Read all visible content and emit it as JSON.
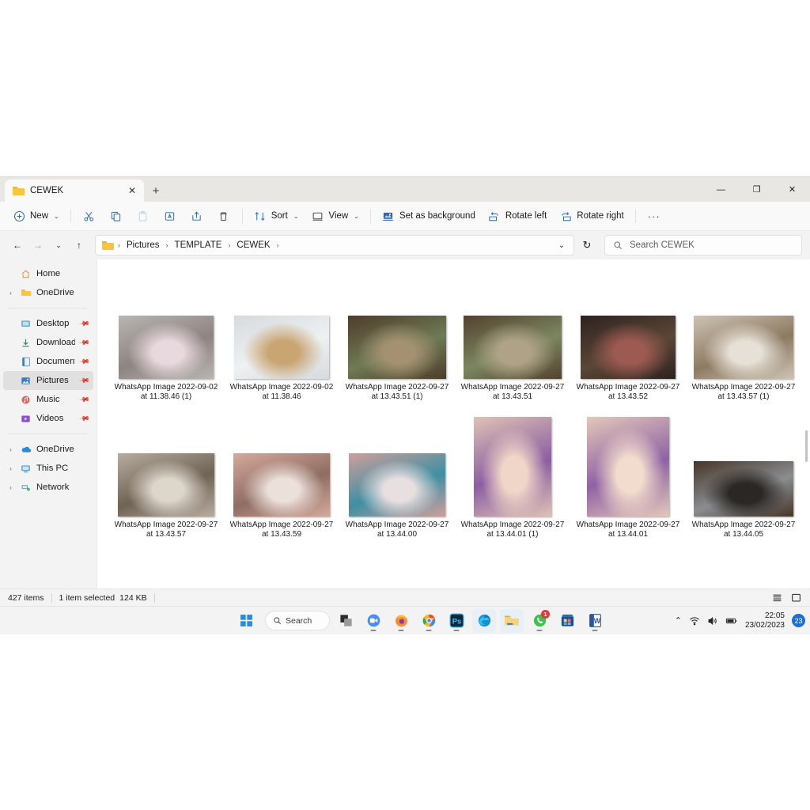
{
  "window": {
    "tab_title": "CEWEK",
    "tab_close": "✕",
    "new_tab": "+",
    "minimize": "—",
    "maximize": "❐",
    "close": "✕"
  },
  "toolbar": {
    "new_label": "New",
    "cut_label": "Cut",
    "copy_label": "Copy",
    "paste_label": "Paste",
    "rename_label": "Rename",
    "share_label": "Share",
    "delete_label": "Delete",
    "sort_label": "Sort",
    "view_label": "View",
    "set_as_background_label": "Set as background",
    "rotate_left_label": "Rotate left",
    "rotate_right_label": "Rotate right",
    "more_label": "···",
    "chevron": "⌄"
  },
  "address": {
    "back": "←",
    "forward": "→",
    "recent": "⌄",
    "up": "↑",
    "crumbs": [
      "Pictures",
      "TEMPLATE",
      "CEWEK"
    ],
    "separator": "›",
    "dropdown": "⌄",
    "refresh": "↻"
  },
  "search": {
    "placeholder": "Search CEWEK"
  },
  "sidebar": {
    "groups": [
      {
        "items": [
          {
            "label": "Home",
            "icon": "home-icon",
            "expand": "",
            "pin": false,
            "selected": false
          },
          {
            "label": "OneDrive",
            "icon": "onedrive-folder-icon",
            "expand": "›",
            "pin": false,
            "selected": false
          }
        ]
      },
      {
        "items": [
          {
            "label": "Desktop",
            "icon": "desktop-icon",
            "expand": "",
            "pin": true,
            "selected": false
          },
          {
            "label": "Downloads",
            "icon": "downloads-icon",
            "expand": "",
            "pin": true,
            "selected": false
          },
          {
            "label": "Documents",
            "icon": "documents-icon",
            "expand": "",
            "pin": true,
            "selected": false
          },
          {
            "label": "Pictures",
            "icon": "pictures-icon",
            "expand": "",
            "pin": true,
            "selected": true
          },
          {
            "label": "Music",
            "icon": "music-icon",
            "expand": "",
            "pin": true,
            "selected": false
          },
          {
            "label": "Videos",
            "icon": "videos-icon",
            "expand": "",
            "pin": true,
            "selected": false
          }
        ]
      },
      {
        "items": [
          {
            "label": "OneDrive",
            "icon": "onedrive-cloud-icon",
            "expand": "›",
            "pin": false,
            "selected": false
          },
          {
            "label": "This PC",
            "icon": "this-pc-icon",
            "expand": "›",
            "pin": false,
            "selected": false
          },
          {
            "label": "Network",
            "icon": "network-icon",
            "expand": "›",
            "pin": false,
            "selected": false
          }
        ]
      }
    ]
  },
  "files": [
    {
      "name": "WhatsApp Image 2022-09-02 at 11.38.46 (1)",
      "w": 120,
      "h": 80,
      "c1": "#b9b5b2",
      "c2": "#e8d9de",
      "c3": "#8d8480",
      "selected": false
    },
    {
      "name": "WhatsApp Image 2022-09-02 at 11.38.46",
      "w": 120,
      "h": 80,
      "c1": "#d6dadd",
      "c2": "#c9a572",
      "c3": "#eef1f3",
      "selected": false
    },
    {
      "name": "WhatsApp Image 2022-09-27 at 13.43.51 (1)",
      "w": 124,
      "h": 80,
      "c1": "#4e3c2b",
      "c2": "#a39171",
      "c3": "#6e7a55",
      "selected": false
    },
    {
      "name": "WhatsApp Image 2022-09-27 at 13.43.51",
      "w": 124,
      "h": 80,
      "c1": "#53412f",
      "c2": "#b0a286",
      "c3": "#7b8660",
      "selected": false
    },
    {
      "name": "WhatsApp Image 2022-09-27 at 13.43.52",
      "w": 120,
      "h": 80,
      "c1": "#2d2220",
      "c2": "#9c5a52",
      "c3": "#5b4636",
      "selected": false
    },
    {
      "name": "WhatsApp Image 2022-09-27 at 13.43.57 (1)",
      "w": 126,
      "h": 80,
      "c1": "#cdc3b4",
      "c2": "#e6e0d6",
      "c3": "#8d7a62",
      "selected": false
    },
    {
      "name": "WhatsApp Image 2022-09-27 at 13.43.57",
      "w": 122,
      "h": 80,
      "c1": "#b7ada0",
      "c2": "#dcd6cb",
      "c3": "#6f6354",
      "selected": false
    },
    {
      "name": "WhatsApp Image 2022-09-27 at 13.43.59",
      "w": 122,
      "h": 80,
      "c1": "#d6a99c",
      "c2": "#ece0db",
      "c3": "#8e6d62",
      "selected": false
    },
    {
      "name": "WhatsApp Image 2022-09-27 at 13.44.00",
      "w": 122,
      "h": 80,
      "c1": "#cf9f9c",
      "c2": "#e8dfe0",
      "c3": "#3f8fa3",
      "selected": false
    },
    {
      "name": "WhatsApp Image 2022-09-27 at 13.44.01 (1)",
      "w": 98,
      "h": 126,
      "c1": "#dfc2b5",
      "c2": "#f0d6c8",
      "c3": "#8b5ea1",
      "selected": false
    },
    {
      "name": "WhatsApp Image 2022-09-27 at 13.44.01",
      "w": 104,
      "h": 126,
      "c1": "#e3c8ba",
      "c2": "#f2dccd",
      "c3": "#8f62a4",
      "selected": false
    },
    {
      "name": "WhatsApp Image 2022-09-27 at 13.44.05",
      "w": 126,
      "h": 70,
      "c1": "#463528",
      "c2": "#2a2724",
      "c3": "#8a8d90",
      "selected": false
    },
    {
      "name": "",
      "w": 124,
      "h": 82,
      "c1": "#4b352a",
      "c2": "#cbb58a",
      "c3": "#6b5a3e",
      "selected": true
    },
    {
      "name": "",
      "w": 126,
      "h": 98,
      "c1": "#a8a6a4",
      "c2": "#d8a8a2",
      "c3": "#c9bfae",
      "selected": false
    },
    {
      "name": "",
      "w": 124,
      "h": 82,
      "c1": "#14100f",
      "c2": "#6c625a",
      "c3": "#2b2522",
      "selected": false
    },
    {
      "name": "",
      "w": 126,
      "h": 82,
      "c1": "#bfc47a",
      "c2": "#e3e05a",
      "c3": "#d7d34f",
      "selected": false
    },
    {
      "name": "",
      "w": 124,
      "h": 82,
      "c1": "#7d4a31",
      "c2": "#a3704c",
      "c3": "#3d2a1c",
      "selected": false
    },
    {
      "name": "",
      "w": 124,
      "h": 82,
      "c1": "#d7d4cf",
      "c2": "#2a2a2a",
      "c3": "#2f5fa8",
      "selected": false
    }
  ],
  "status": {
    "item_count": "427 items",
    "selection": "1 item selected",
    "size": "124 KB",
    "details_view": "details-view-icon",
    "large_icons_view": "large-icons-view-icon"
  },
  "taskbar": {
    "start": "start-icon",
    "search_label": "Search",
    "apps": [
      {
        "name": "file-explorer-legacy-icon"
      },
      {
        "name": "zoom-icon"
      },
      {
        "name": "firefox-icon"
      },
      {
        "name": "chrome-icon"
      },
      {
        "name": "photoshop-icon"
      },
      {
        "name": "edge-icon"
      },
      {
        "name": "file-explorer-icon"
      },
      {
        "name": "whatsapp-icon"
      },
      {
        "name": "microsoft-store-icon"
      },
      {
        "name": "word-icon"
      }
    ],
    "whatsapp_badge": "1",
    "tray": {
      "chevron": "⌃",
      "wifi": "wifi-icon",
      "volume": "volume-icon",
      "battery": "battery-icon"
    },
    "time": "22:05",
    "date": "23/02/2023",
    "notification_count": "23"
  }
}
